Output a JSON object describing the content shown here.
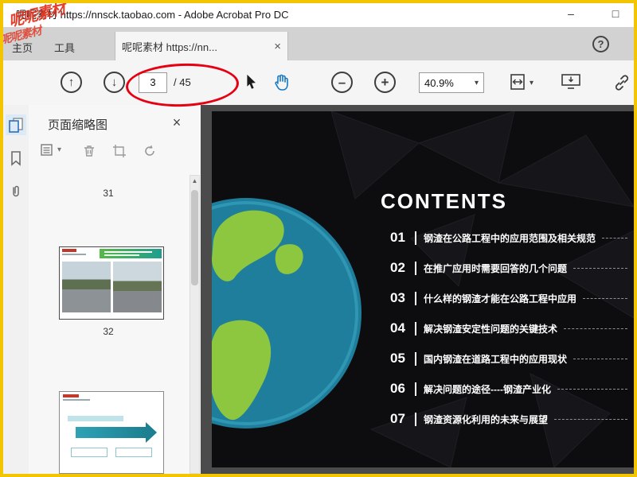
{
  "window": {
    "title": "呢呢素材 https://nnsck.taobao.com - Adobe Acrobat Pro DC",
    "minimize_label": "–",
    "maximize_label": "□"
  },
  "watermark": {
    "primary": "呢呢素材",
    "secondary": "呢呢素材"
  },
  "tab_bar": {
    "home_tab": "主页",
    "tools_tab": "工具",
    "document_tab": "呢呢素材 https://nn...",
    "close_label": "×",
    "help_label": "?"
  },
  "toolbar": {
    "up_arrow": "↑",
    "down_arrow": "↓",
    "page_current": "3",
    "page_total_label": "/ 45",
    "zoom_value": "40.9%",
    "caret": "▾"
  },
  "sidebar_panel": {
    "title": "页面缩略图",
    "close_label": "×",
    "options_caret": "▾",
    "scroll_up": "▲",
    "thumb_prev_label": "31",
    "thumb_current_label": "32"
  },
  "collapse_handle": "◀",
  "slide": {
    "title": "CONTENTS",
    "items": [
      {
        "num": "01",
        "text": "钢渣在公路工程中的应用范围及相关规范"
      },
      {
        "num": "02",
        "text": "在推广应用时需要回答的几个问题"
      },
      {
        "num": "03",
        "text": "什么样的钢渣才能在公路工程中应用"
      },
      {
        "num": "04",
        "text": "解决钢渣安定性问题的关键技术"
      },
      {
        "num": "05",
        "text": "国内钢渣在道路工程中的应用现状"
      },
      {
        "num": "06",
        "text": "解决问题的途径----钢渣产业化"
      },
      {
        "num": "07",
        "text": "钢渣资源化利用的未来与展望"
      }
    ]
  },
  "colors": {
    "frame_border": "#f2c500",
    "annotation_red": "#e60012",
    "globe_teal": "#1e7e9c",
    "continent_green": "#8dc63f",
    "hand_blue": "#1777c2",
    "thumb_teal": "#2ea3b5"
  }
}
